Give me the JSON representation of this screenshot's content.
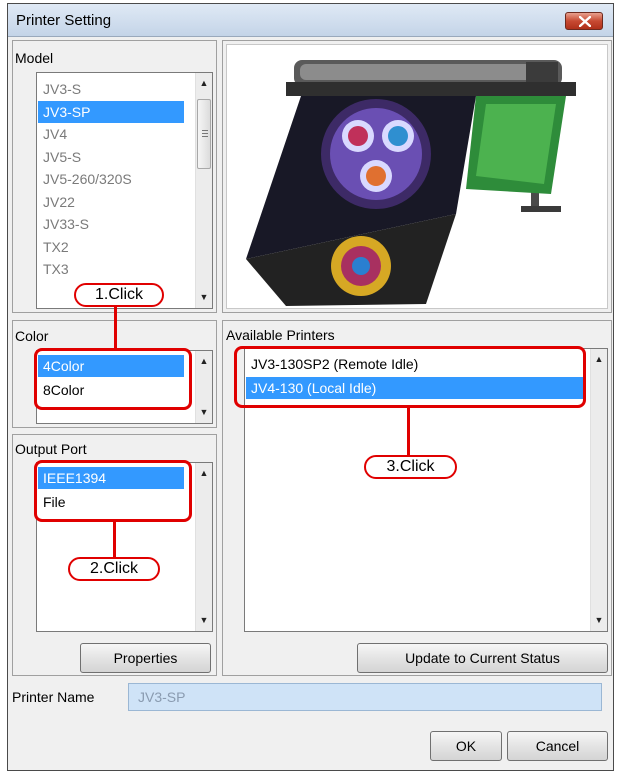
{
  "window": {
    "title": "Printer Setting"
  },
  "model": {
    "label": "Model",
    "items": [
      "JV3-S",
      "JV3-SP",
      "JV4",
      "JV5-S",
      "JV5-260/320S",
      "JV22",
      "JV33-S",
      "TX2",
      "TX3"
    ],
    "selected": "JV3-SP"
  },
  "color": {
    "label": "Color",
    "items": [
      "4Color",
      "8Color"
    ],
    "selected": "4Color"
  },
  "output_port": {
    "label": "Output Port",
    "items": [
      "IEEE1394",
      "File"
    ],
    "selected": "IEEE1394"
  },
  "available_printers": {
    "label": "Available Printers",
    "items": [
      "JV3-130SP2 (Remote Idle)",
      "JV4-130 (Local Idle)"
    ],
    "selected": "JV4-130 (Local Idle)"
  },
  "buttons": {
    "properties": "Properties",
    "update": "Update to Current Status",
    "ok": "OK",
    "cancel": "Cancel"
  },
  "printer_name": {
    "label": "Printer Name",
    "value": "JV3-SP"
  },
  "annotations": {
    "step1": "1.Click",
    "step2": "2.Click",
    "step3": "3.Click"
  },
  "colors": {
    "selection": "#3399ff",
    "callout": "#e00000",
    "name_field": "#cfe3f7"
  }
}
